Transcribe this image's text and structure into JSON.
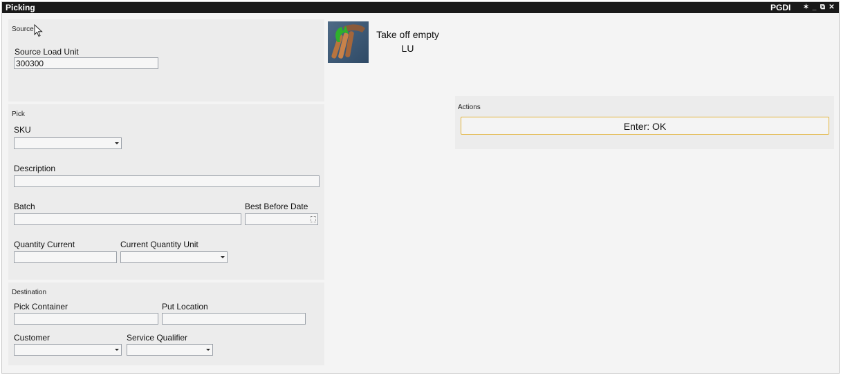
{
  "window": {
    "title": "Picking",
    "right_label": "PGDI",
    "controls": [
      {
        "name": "pin-icon",
        "glyph": "✶"
      },
      {
        "name": "minimize-icon",
        "glyph": "_"
      },
      {
        "name": "restore-icon",
        "glyph": "⧉"
      },
      {
        "name": "close-icon",
        "glyph": "✕"
      }
    ]
  },
  "source": {
    "panel_title": "Source",
    "load_unit_label": "Source Load Unit",
    "load_unit_value": "300300"
  },
  "pick": {
    "panel_title": "Pick",
    "sku_label": "SKU",
    "sku_value": "",
    "description_label": "Description",
    "description_value": "",
    "batch_label": "Batch",
    "batch_value": "",
    "best_before_label": "Best Before Date",
    "best_before_value": "",
    "quantity_current_label": "Quantity Current",
    "quantity_current_value": "",
    "current_quantity_unit_label": "Current Quantity Unit",
    "current_quantity_unit_value": ""
  },
  "destination": {
    "panel_title": "Destination",
    "pick_container_label": "Pick Container",
    "pick_container_value": "",
    "put_location_label": "Put Location",
    "put_location_value": "",
    "customer_label": "Customer",
    "customer_value": "",
    "service_qualifier_label": "Service Qualifier",
    "service_qualifier_value": ""
  },
  "instruction": {
    "icon": "load-unit-icon",
    "text_line1": "Take off empty",
    "text_line2": "LU"
  },
  "actions": {
    "panel_title": "Actions",
    "ok_label": "Enter: OK"
  },
  "colors": {
    "titlebar": "#1a1a1a",
    "panel": "#ececec",
    "button_border": "#e3b43a"
  }
}
